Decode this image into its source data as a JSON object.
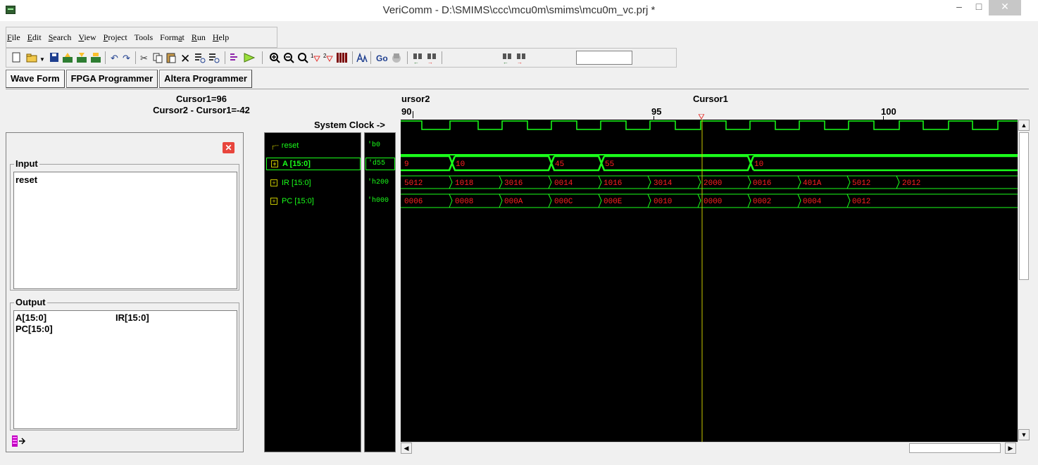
{
  "window": {
    "title": "VeriComm - D:\\SMIMS\\ccc\\mcu0m\\smims\\mcu0m_vc.prj *",
    "controls": {
      "minimize": "–",
      "maximize": "□",
      "close": "✕"
    }
  },
  "menu": {
    "items": [
      {
        "pre": "",
        "u": "F",
        "post": "ile"
      },
      {
        "pre": "",
        "u": "E",
        "post": "dit"
      },
      {
        "pre": "",
        "u": "S",
        "post": "earch"
      },
      {
        "pre": "",
        "u": "V",
        "post": "iew"
      },
      {
        "pre": "",
        "u": "P",
        "post": "roject"
      },
      {
        "pre": "Tools",
        "u": "",
        "post": ""
      },
      {
        "pre": "Form",
        "u": "a",
        "post": "t"
      },
      {
        "pre": "",
        "u": "R",
        "post": "un"
      },
      {
        "pre": "",
        "u": "H",
        "post": "elp"
      }
    ]
  },
  "toolbar": {
    "go_label": "Go",
    "search_value": ""
  },
  "tabs": [
    {
      "label": "Wave Form",
      "active": true
    },
    {
      "label": "FPGA Programmer",
      "active": false
    },
    {
      "label": "Altera Programmer",
      "active": false
    }
  ],
  "cursor_info": {
    "cursor1": "Cursor1=96",
    "delta": "Cursor2 - Cursor1=-42",
    "system_clock": "System Clock ->"
  },
  "input_group": {
    "label": "Input",
    "items": [
      "reset"
    ]
  },
  "output_group": {
    "label": "Output",
    "items": [
      "A[15:0]",
      "IR[15:0]",
      "PC[15:0]"
    ]
  },
  "signals": [
    {
      "name": "reset",
      "value": "'b0",
      "bus": false,
      "selected": false
    },
    {
      "name": "A [15:0]",
      "value": "'d55",
      "bus": true,
      "selected": true
    },
    {
      "name": "IR [15:0]",
      "value": "'h200",
      "bus": true,
      "selected": false
    },
    {
      "name": "PC [15:0]",
      "value": "'h000",
      "bus": true,
      "selected": false
    }
  ],
  "wave_header": {
    "cursor2_label": "ursor2",
    "cursor1_label": "Cursor1",
    "ticks": [
      "90",
      "95",
      "100"
    ]
  },
  "waves": {
    "A": [
      "9",
      "10",
      "45",
      "55",
      "10"
    ],
    "IR": [
      "5012",
      "1018",
      "3016",
      "0014",
      "1016",
      "3014",
      "2000",
      "0016",
      "401A",
      "5012",
      "2012"
    ],
    "PC": [
      "0006",
      "0008",
      "000A",
      "000C",
      "000E",
      "0010",
      "0000",
      "0002",
      "0004",
      "0012"
    ]
  },
  "colors": {
    "wave_green": "#1aff1a",
    "bus_text": "#ff2020",
    "cursor_line": "#c8c800",
    "background": "#000000"
  }
}
